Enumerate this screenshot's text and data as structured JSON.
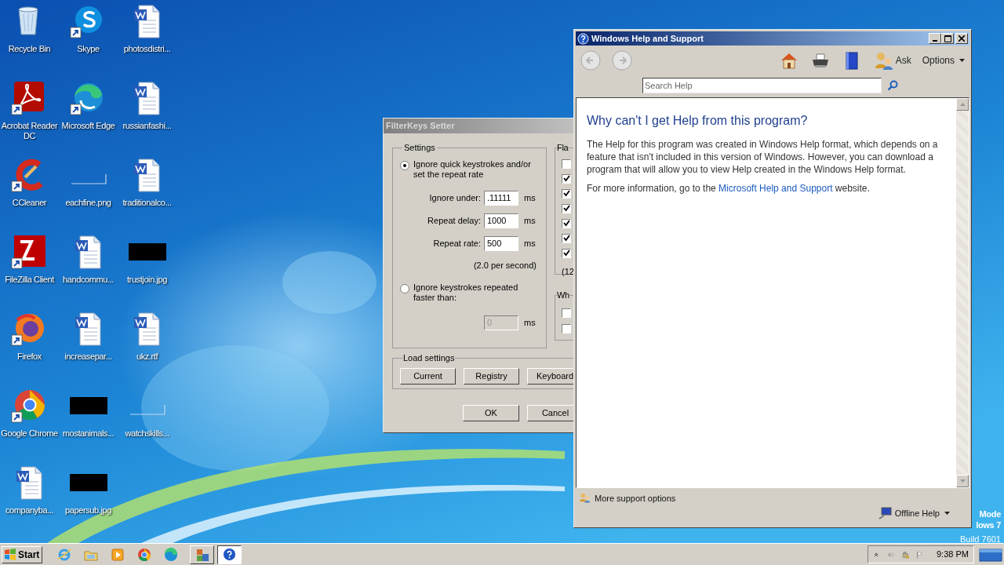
{
  "desktop_icons": [
    {
      "label": "Recycle Bin",
      "kind": "recycle",
      "shortcut": false
    },
    {
      "label": "Acrobat Reader DC",
      "kind": "acrobat",
      "shortcut": true
    },
    {
      "label": "CCleaner",
      "kind": "ccleaner",
      "shortcut": true
    },
    {
      "label": "FileZilla Client",
      "kind": "filezilla",
      "shortcut": true
    },
    {
      "label": "Firefox",
      "kind": "firefox",
      "shortcut": true
    },
    {
      "label": "Google Chrome",
      "kind": "chrome",
      "shortcut": true
    },
    {
      "label": "companyba...",
      "kind": "word",
      "shortcut": false
    },
    {
      "label": "Skype",
      "kind": "skype",
      "shortcut": true
    },
    {
      "label": "Microsoft Edge",
      "kind": "edge",
      "shortcut": true
    },
    {
      "label": "eachfine.png",
      "kind": "image_blank",
      "shortcut": false
    },
    {
      "label": "handcommu...",
      "kind": "word",
      "shortcut": false
    },
    {
      "label": "increasepar...",
      "kind": "word",
      "shortcut": false
    },
    {
      "label": "mostanimals...",
      "kind": "image_black",
      "shortcut": false
    },
    {
      "label": "papersub.jpg",
      "kind": "image_black",
      "shortcut": false
    },
    {
      "label": "photosdistri...",
      "kind": "word",
      "shortcut": false
    },
    {
      "label": "russianfashi...",
      "kind": "word",
      "shortcut": false
    },
    {
      "label": "traditionalco...",
      "kind": "word",
      "shortcut": false
    },
    {
      "label": "trustjoin.jpg",
      "kind": "image_black",
      "shortcut": false
    },
    {
      "label": "ukz.rtf",
      "kind": "word",
      "shortcut": false
    },
    {
      "label": "watchskills...",
      "kind": "image_blank",
      "shortcut": false
    }
  ],
  "filterkeys_dialog": {
    "title": "FilterKeys Setter",
    "settings": {
      "label": "Settings",
      "options": [
        {
          "label": "Ignore quick keystrokes and/or set the repeat rate",
          "selected": true
        },
        {
          "label": "Ignore keystrokes repeated faster than:",
          "selected": false
        }
      ],
      "fields": [
        {
          "label": "Ignore under:",
          "value": ".11111",
          "unit": "ms",
          "disabled": false
        },
        {
          "label": "Repeat delay:",
          "value": "1000",
          "unit": "ms",
          "disabled": false
        },
        {
          "label": "Repeat rate:",
          "value": "500",
          "unit": "ms",
          "disabled": false
        }
      ],
      "rate_note": "(2.0 per second)",
      "threshold_field": {
        "value": "0",
        "unit": "ms",
        "disabled": true
      }
    },
    "flags": {
      "label": "Fla",
      "checkboxes": [
        {
          "checked": false
        },
        {
          "checked": true
        },
        {
          "checked": true
        },
        {
          "checked": true
        },
        {
          "checked": true
        },
        {
          "checked": true
        },
        {
          "checked": true
        }
      ],
      "note": "(12"
    },
    "wh_group": {
      "label": "Wh",
      "checkboxes": [
        {
          "checked": false
        },
        {
          "checked": false
        }
      ]
    },
    "load_settings": {
      "label": "Load settings",
      "buttons": [
        "Current",
        "Registry",
        "Keyboard"
      ]
    },
    "buttons": [
      "OK",
      "Cancel"
    ]
  },
  "help_window": {
    "title": "Windows Help and Support",
    "ask": "Ask",
    "options": "Options",
    "search": {
      "placeholder": "Search Help"
    },
    "heading": "Why can't I get Help from this program?",
    "paragraph": "The Help for this program was created in Windows Help format, which depends on a feature that isn't included in this version of Windows. However, you can download a program that will allow you to view Help created in the Windows Help format.",
    "more_info": {
      "before": "For more information, go to the ",
      "link": "Microsoft Help and Support",
      "after": " website."
    },
    "more_support": "More support options",
    "offline_help": "Offline Help"
  },
  "desktop_notice": [
    "Mode",
    "lows 7",
    "Build 7601"
  ],
  "taskbar": {
    "start": "Start",
    "tasks": [
      {
        "kind": "filterkeys",
        "selected": false
      },
      {
        "kind": "help",
        "selected": true
      }
    ],
    "clock": "9:38 PM"
  }
}
